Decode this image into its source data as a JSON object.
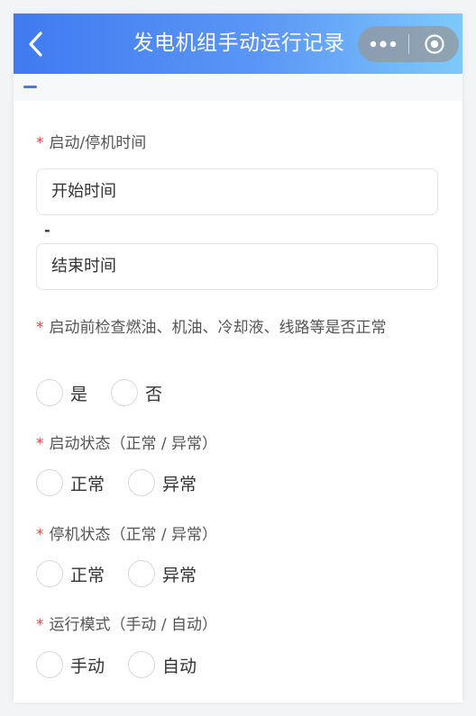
{
  "navbar": {
    "title": "发电机组手动运行记录",
    "back_icon": "chevron-left-icon",
    "more_icon": "more-dots-icon",
    "close_icon": "target-close-icon"
  },
  "form": {
    "time_range": {
      "required_mark": "*",
      "label": "启动/停机时间",
      "start_placeholder": "开始时间",
      "separator": "-",
      "end_placeholder": "结束时间"
    },
    "precheck": {
      "required_mark": "*",
      "label": "启动前检查燃油、机油、冷却液、线路等是否正常",
      "options": [
        "是",
        "否"
      ]
    },
    "start_status": {
      "required_mark": "*",
      "label": "启动状态（正常 / 异常）",
      "options": [
        "正常",
        "异常"
      ]
    },
    "stop_status": {
      "required_mark": "*",
      "label": "停机状态（正常 / 异常）",
      "options": [
        "正常",
        "异常"
      ]
    },
    "run_mode": {
      "required_mark": "*",
      "label": "运行模式（手动 / 自动）",
      "options": [
        "手动",
        "自动"
      ]
    }
  },
  "colors": {
    "accent": "#3f7bf0",
    "required": "#e64340"
  }
}
